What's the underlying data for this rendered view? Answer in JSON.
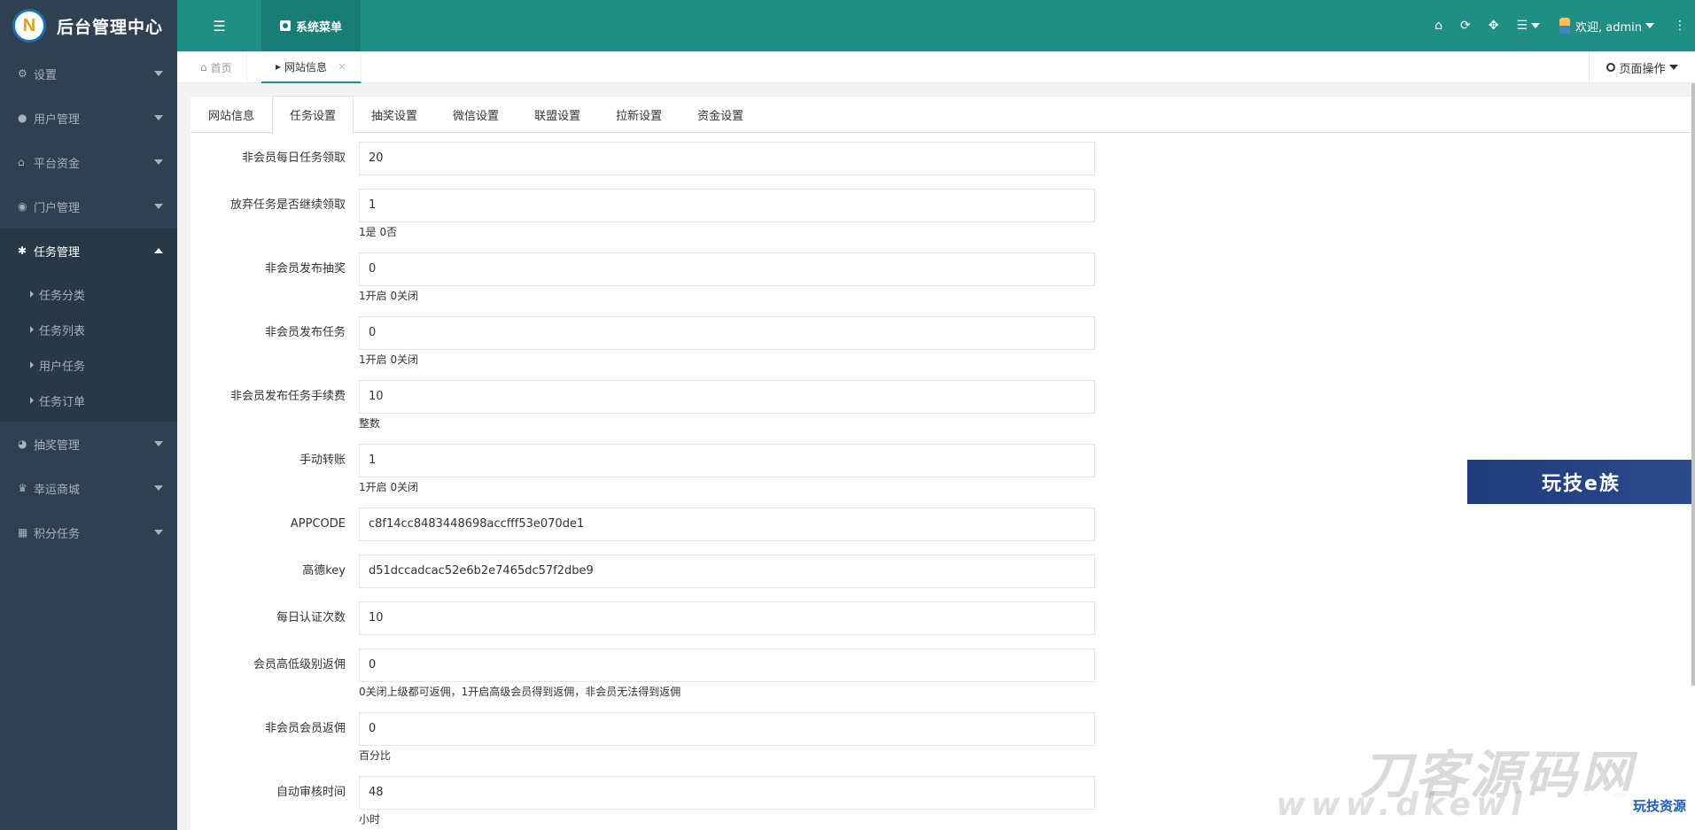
{
  "brand": {
    "title": "后台管理中心",
    "logo": "N"
  },
  "header": {
    "menu_toggle_icon": "list-icon",
    "system_menu": "系统菜单",
    "user": "欢迎, admin"
  },
  "sidebar": {
    "items": [
      {
        "label": "设置",
        "icon": "gears-icon"
      },
      {
        "label": "用户管理",
        "icon": "users-icon"
      },
      {
        "label": "平台资金",
        "icon": "bank-icon"
      },
      {
        "label": "门户管理",
        "icon": "globe-icon"
      },
      {
        "label": "任务管理",
        "icon": "bug-icon"
      },
      {
        "label": "抽奖管理",
        "icon": "compass-icon"
      },
      {
        "label": "幸运商城",
        "icon": "shopping-icon"
      },
      {
        "label": "积分任务",
        "icon": "grid-icon"
      }
    ],
    "sub_items": [
      "任务分类",
      "任务列表",
      "用户任务",
      "任务订单"
    ]
  },
  "page_tabs": {
    "home": "首页",
    "current": "网站信息",
    "close": "×",
    "page_ops": "页面操作"
  },
  "tabs": [
    "网站信息",
    "任务设置",
    "抽奖设置",
    "微信设置",
    "联盟设置",
    "拉新设置",
    "资金设置"
  ],
  "form": [
    {
      "label": "非会员每日任务领取",
      "value": "20",
      "help": ""
    },
    {
      "label": "放弃任务是否继续领取",
      "value": "1",
      "help": "1是 0否"
    },
    {
      "label": "非会员发布抽奖",
      "value": "0",
      "help": "1开启 0关闭"
    },
    {
      "label": "非会员发布任务",
      "value": "0",
      "help": "1开启 0关闭"
    },
    {
      "label": "非会员发布任务手续费",
      "value": "10",
      "help": "整数"
    },
    {
      "label": "手动转账",
      "value": "1",
      "help": "1开启 0关闭"
    },
    {
      "label": "APPCODE",
      "value": "c8f14cc8483448698accfff53e070de1",
      "help": ""
    },
    {
      "label": "高德key",
      "value": "d51dccadcac52e6b2e7465dc57f2dbe9",
      "help": ""
    },
    {
      "label": "每日认证次数",
      "value": "10",
      "help": ""
    },
    {
      "label": "会员高低级别返佣",
      "value": "0",
      "help": "0关闭上级都可返佣，1开启高级会员得到返佣，非会员无法得到返佣"
    },
    {
      "label": "非会员会员返佣",
      "value": "0",
      "help": "百分比"
    },
    {
      "label": "自动审核时间",
      "value": "48",
      "help": "小时"
    }
  ],
  "overlay": {
    "ad_text": "玩技e族",
    "watermark_main": "刀客源码网",
    "watermark_url": "www.dkewl",
    "watermark_badge": "玩技资源"
  }
}
